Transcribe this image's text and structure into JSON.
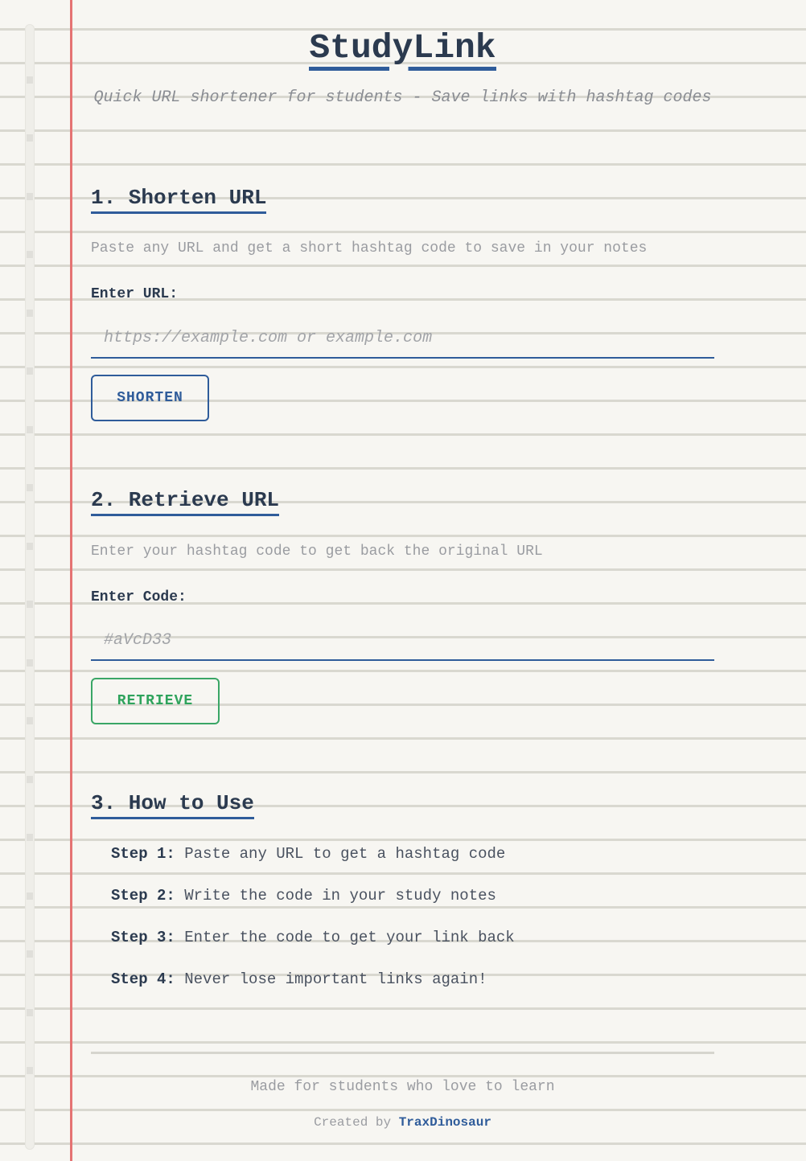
{
  "header": {
    "title": "StudyLink",
    "subtitle": "Quick URL shortener for students - Save links with hashtag codes"
  },
  "shorten": {
    "heading": "1. Shorten URL",
    "description": "Paste any URL and get a short hashtag code to save in your notes",
    "label": "Enter URL:",
    "placeholder": "https://example.com or example.com",
    "button_label": "SHORTEN"
  },
  "retrieve": {
    "heading": "2. Retrieve URL",
    "description": "Enter your hashtag code to get back the original URL",
    "label": "Enter Code:",
    "placeholder": "#aVcD33",
    "button_label": "RETRIEVE"
  },
  "how_to": {
    "heading": "3. How to Use",
    "steps": [
      {
        "label": "Step 1:",
        "text": "Paste any URL to get a hashtag code"
      },
      {
        "label": "Step 2:",
        "text": "Write the code in your study notes"
      },
      {
        "label": "Step 3:",
        "text": "Enter the code to get your link back"
      },
      {
        "label": "Step 4:",
        "text": "Never lose important links again!"
      }
    ]
  },
  "footer": {
    "tagline": "Made for students who love to learn",
    "credit_prefix": "Created by",
    "credit_name": "TraxDinosaur"
  },
  "colors": {
    "paper": "#f7f6f2",
    "rule_line": "#d9d8d0",
    "margin_line": "#e57373",
    "ink_dark": "#2b3a4f",
    "accent_blue": "#2f5c9a",
    "accent_green": "#2ea35c",
    "muted_text": "#9a9ca1"
  }
}
